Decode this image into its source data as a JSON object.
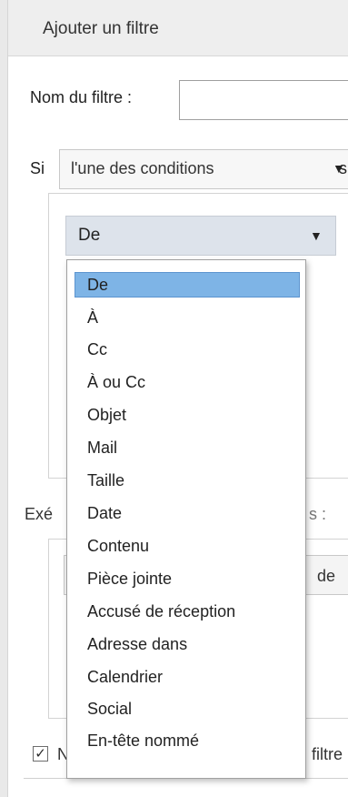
{
  "panel": {
    "title": "Ajouter un filtre"
  },
  "filter_name": {
    "label": "Nom du filtre :",
    "value": "",
    "placeholder": ""
  },
  "condition": {
    "prefix": "Si",
    "selected": "l'une des conditions",
    "suffix": "s"
  },
  "rule": {
    "field_selected": "De"
  },
  "dropdown": {
    "options": [
      "De",
      "À",
      "Cc",
      "À ou Cc",
      "Objet",
      "Mail",
      "Taille",
      "Date",
      "Contenu",
      "Pièce jointe",
      "Accusé de réception",
      "Adresse dans",
      "Calendrier",
      "Social",
      "En-tête nommé"
    ],
    "selected_index": 0
  },
  "actions": {
    "label_start": "Exé",
    "label_end": "s :",
    "action_text": "de"
  },
  "options": {
    "checkbox_checked": true,
    "checkbox_label_start": "N",
    "checkbox_label_end": "filtre"
  },
  "colors": {
    "highlight": "#7eb4e6",
    "select_bg": "#dde3eb"
  }
}
